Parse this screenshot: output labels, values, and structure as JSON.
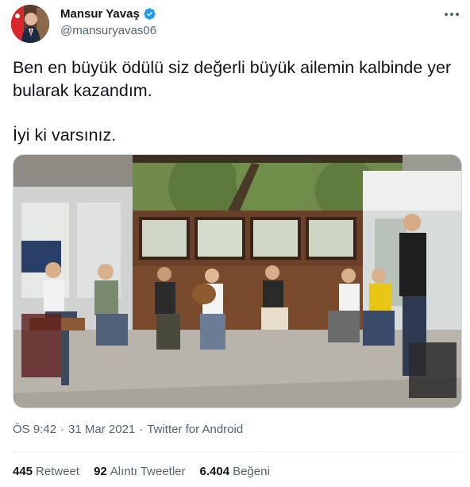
{
  "author": {
    "name": "Mansur Yavaş",
    "handle": "@mansuryavas06",
    "verified": true,
    "avatar_icon": "profile-photo-with-flag"
  },
  "tweet": {
    "line1": "Ben en büyük ödülü siz değerli büyük ailemin kalbinde yer bularak kazandım.",
    "line2": "İyi ki varsınız.",
    "media_description_icon": "video-thumbnail"
  },
  "meta": {
    "time": "ÖS 9:42",
    "separator": "·",
    "date": "31 Mar 2021",
    "source": "Twitter for Android"
  },
  "stats": {
    "retweets_count": "445",
    "retweets_label": "Retweet",
    "quotes_count": "92",
    "quotes_label": "Alıntı Tweetler",
    "likes_count": "6.404",
    "likes_label": "Beğeni"
  },
  "colors": {
    "verified": "#1d9bf0",
    "secondary_text": "#536471",
    "primary_text": "#0f1419"
  }
}
